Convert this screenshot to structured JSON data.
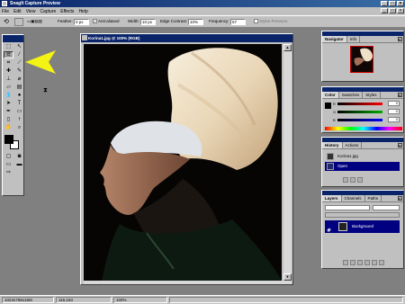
{
  "window": {
    "title": "SnagIt Capture Preview"
  },
  "menu": {
    "items": [
      "File",
      "Edit",
      "View",
      "Capture",
      "Effects",
      "Help"
    ]
  },
  "options": {
    "feather_label": "Feather:",
    "feather_value": "0 px",
    "antialiased_label": "Anti-aliased",
    "width_label": "Width:",
    "width_value": "10 px",
    "edge_contrast_label": "Edge Contrast:",
    "edge_contrast_value": "10%",
    "frequency_label": "Frequency:",
    "frequency_value": "57",
    "stylus_label": "Stylus Pressure"
  },
  "document": {
    "title": "Korina1.jpg @ 100% (RGB)"
  },
  "navigator": {
    "tabs": [
      "Navigator",
      "Info"
    ]
  },
  "color_panel": {
    "tabs": [
      "Color",
      "Swatches",
      "Styles"
    ],
    "r_label": "R",
    "g_label": "G",
    "b_label": "B",
    "r_value": "0",
    "g_value": "0",
    "b_value": "0"
  },
  "history": {
    "tabs": [
      "History",
      "Actions"
    ],
    "items": [
      "Korina1.jpg",
      "Open"
    ]
  },
  "layers": {
    "tabs": [
      "Layers",
      "Channels",
      "Paths"
    ],
    "layer_name": "Background"
  },
  "status": {
    "dimensions": "1024x768x16M",
    "coords": "116,163",
    "zoom": "100%"
  },
  "colors": {
    "title_bar": "#0a246a",
    "chrome": "#c0c0c0",
    "arrow": "#f4f414",
    "selection": "#000080"
  }
}
